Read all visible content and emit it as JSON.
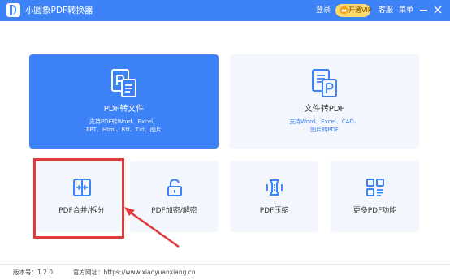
{
  "app": {
    "title": "小圆象PDF转换器"
  },
  "titlebar": {
    "login": "登录",
    "vip": "开通VIP",
    "help": "客服",
    "menu": "菜单"
  },
  "cards": {
    "pdf_to_file": {
      "title": "PDF转文件",
      "desc_line1": "支持PDF转Word、Excel、",
      "desc_line2": "PPT、Html、Rtf、Txt、图片"
    },
    "file_to_pdf": {
      "title": "文件转PDF",
      "desc_line1": "支持Word、Excel、CAD、",
      "desc_line2": "图片转PDF"
    },
    "merge_split": {
      "title": "PDF合并/拆分"
    },
    "encrypt_decrypt": {
      "title": "PDF加密/解密"
    },
    "compress": {
      "title": "PDF压缩"
    },
    "more": {
      "title": "更多PDF功能"
    }
  },
  "footer": {
    "version": "版本号：1.2.0",
    "website": "官方网址：https://www.xiaoyuanxiang.cn"
  },
  "colors": {
    "primary": "#3d82f6",
    "card_bg": "#f3f6fd",
    "vip_bg": "#ffd96a",
    "annotation": "#e03a3a"
  },
  "icons": [
    "app-logo-icon",
    "crown-icon",
    "minimize-icon",
    "close-icon",
    "pdf-to-file-icon",
    "file-to-pdf-icon",
    "merge-split-icon",
    "lock-icon",
    "compress-icon",
    "grid-more-icon"
  ]
}
